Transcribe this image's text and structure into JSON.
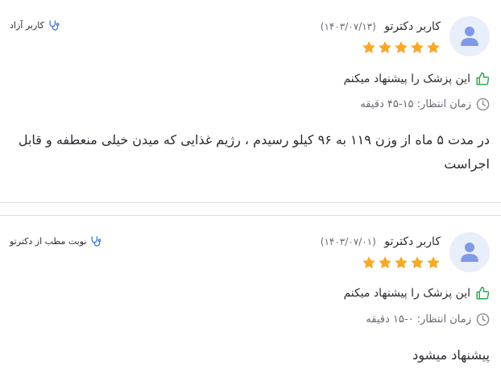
{
  "reviews": [
    {
      "user_name": "کاربر دکترتو",
      "date": "(۱۴۰۳/۰۷/۱۳)",
      "rating": 5,
      "platform_label": "کاربر آزاد",
      "recommend_text": "این پزشک را پیشنهاد میکنم",
      "wait_time": "زمان انتظار: ۱۵-۴۵ دقیقه",
      "comment": "در مدت ۵ ماه از وزن ۱۱۹ به ۹۶ کیلو رسیدم ، رژیم غذایی که میدن خیلی منعطفه و قابل اجراست"
    },
    {
      "user_name": "کاربر دکترتو",
      "date": "(۱۴۰۳/۰۷/۰۱)",
      "rating": 5,
      "platform_label": "نوبت مطب از دکترتو",
      "recommend_text": "این پزشک را پیشنهاد میکنم",
      "wait_time": "زمان انتظار: ۰-۱۵ دقیقه",
      "comment": "پیشنهاد میشود"
    }
  ],
  "colors": {
    "star": "#f7a928",
    "thumb": "#2fa84f",
    "avatar_bg": "#e9eefb",
    "avatar_icon": "#7f9be6",
    "stethoscope": "#3b6fd8"
  }
}
